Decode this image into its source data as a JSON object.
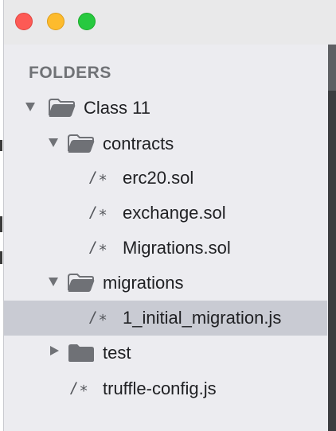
{
  "window": {
    "controls": [
      {
        "name": "close",
        "color": "#fd5a55"
      },
      {
        "name": "minimize",
        "color": "#fdbb2d"
      },
      {
        "name": "maximize",
        "color": "#27c93f"
      }
    ]
  },
  "sidebar": {
    "section_title": "FOLDERS",
    "tree": {
      "root": {
        "label": "Class 11",
        "expanded": true,
        "icon": "folder-open-icon"
      },
      "contracts": {
        "label": "contracts",
        "expanded": true,
        "icon": "folder-open-icon"
      },
      "erc20": {
        "label": "erc20.sol",
        "icon": "/∗"
      },
      "exchange": {
        "label": "exchange.sol",
        "icon": "/∗"
      },
      "migrations_sol": {
        "label": "Migrations.sol",
        "icon": "/∗"
      },
      "migrations": {
        "label": "migrations",
        "expanded": true,
        "icon": "folder-open-icon"
      },
      "initial_migration": {
        "label": "1_initial_migration.js",
        "icon": "/∗",
        "selected": true
      },
      "test": {
        "label": "test",
        "expanded": false,
        "icon": "folder-closed-icon"
      },
      "truffle_config": {
        "label": "truffle-config.js",
        "icon": "/∗"
      }
    }
  },
  "colors": {
    "sidebar_bg": "#ececf0",
    "selected_row_bg": "#c9cbd3",
    "header_text": "#707276",
    "item_text": "#202124"
  }
}
